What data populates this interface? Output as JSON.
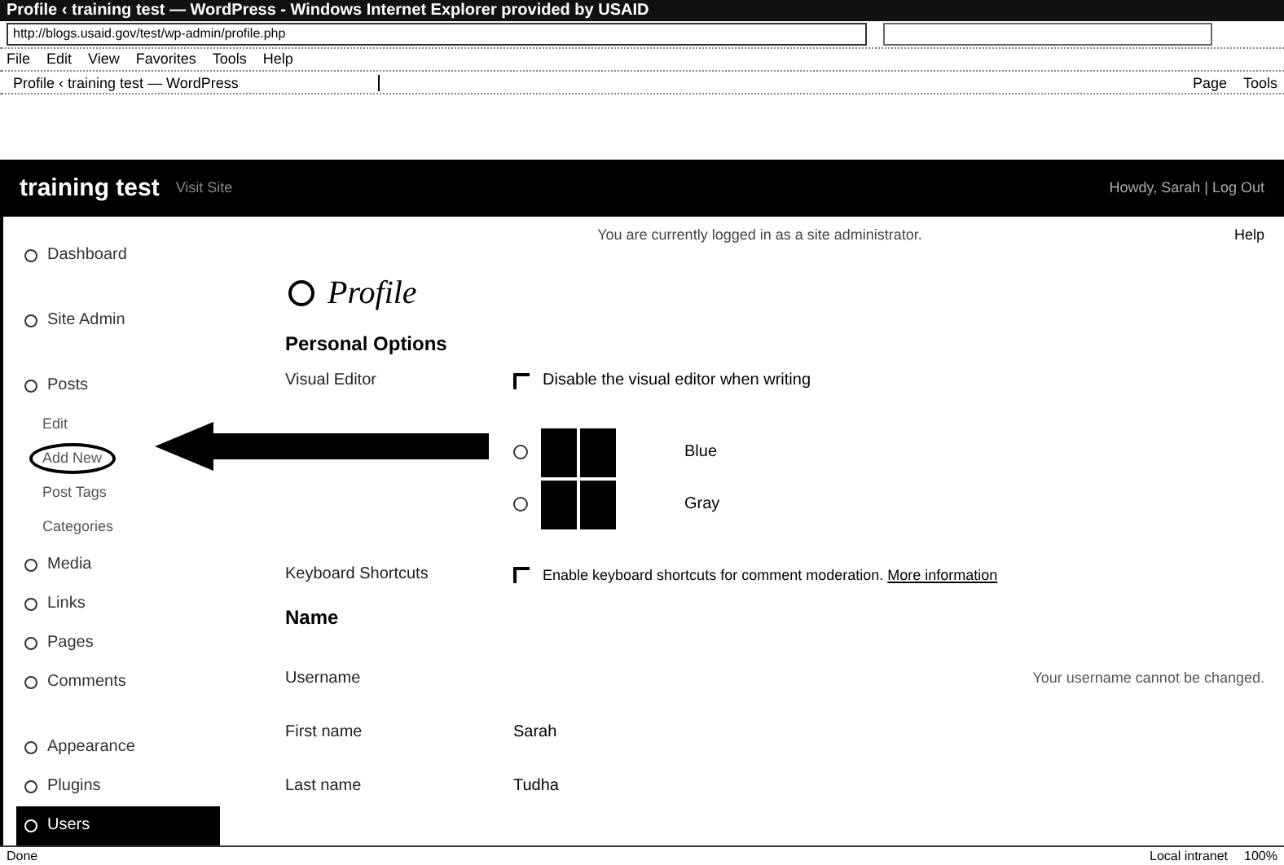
{
  "window": {
    "title": "Profile ‹ training test — WordPress - Windows Internet Explorer provided by USAID"
  },
  "address_bar": {
    "url": "http://blogs.usaid.gov/test/wp-admin/profile.php"
  },
  "menu_bar": [
    "File",
    "Edit",
    "View",
    "Favorites",
    "Tools",
    "Help"
  ],
  "tab": {
    "title": "Profile ‹ training test — WordPress"
  },
  "command_bar": [
    "Page",
    "Tools"
  ],
  "header": {
    "site_title": "training test",
    "visit_site": "Visit Site",
    "user_links": "Howdy, Sarah | Log Out"
  },
  "sidebar": {
    "items": [
      {
        "label": "Dashboard",
        "selected": false
      },
      {
        "label": "Site Admin",
        "selected": false
      },
      {
        "label": "Posts",
        "selected": false,
        "children": [
          {
            "label": "Edit",
            "highlighted": false
          },
          {
            "label": "Add New",
            "highlighted": true
          },
          {
            "label": "Post Tags",
            "highlighted": false
          },
          {
            "label": "Categories",
            "highlighted": false
          }
        ]
      },
      {
        "label": "Media",
        "selected": false
      },
      {
        "label": "Links",
        "selected": false
      },
      {
        "label": "Pages",
        "selected": false
      },
      {
        "label": "Comments",
        "selected": false
      },
      {
        "label": "Appearance",
        "selected": false
      },
      {
        "label": "Plugins",
        "selected": false
      },
      {
        "label": "Users",
        "selected": true
      }
    ]
  },
  "notice": "You are currently logged in as a site administrator.",
  "help": "Help",
  "page_title": "Profile",
  "personal_options": {
    "heading": "Personal Options",
    "visual_editor": {
      "label": "Visual Editor",
      "option": "Disable the visual editor when writing",
      "checked": false
    },
    "color_schemes": [
      {
        "name": "Blue",
        "selected": false
      },
      {
        "name": "Gray",
        "selected": false
      }
    ],
    "keyboard_shortcuts": {
      "label": "Keyboard Shortcuts",
      "option": "Enable keyboard shortcuts for comment moderation.",
      "link": "More information",
      "checked": false
    }
  },
  "name": {
    "heading": "Name",
    "fields": [
      {
        "label": "Username",
        "note": "Your username cannot be changed."
      },
      {
        "label": "First name",
        "value": "Sarah"
      },
      {
        "label": "Last name",
        "value": "Tudha"
      }
    ]
  },
  "status_bar": {
    "status": "Done",
    "zone": "Local intranet",
    "zoom": "100%"
  }
}
